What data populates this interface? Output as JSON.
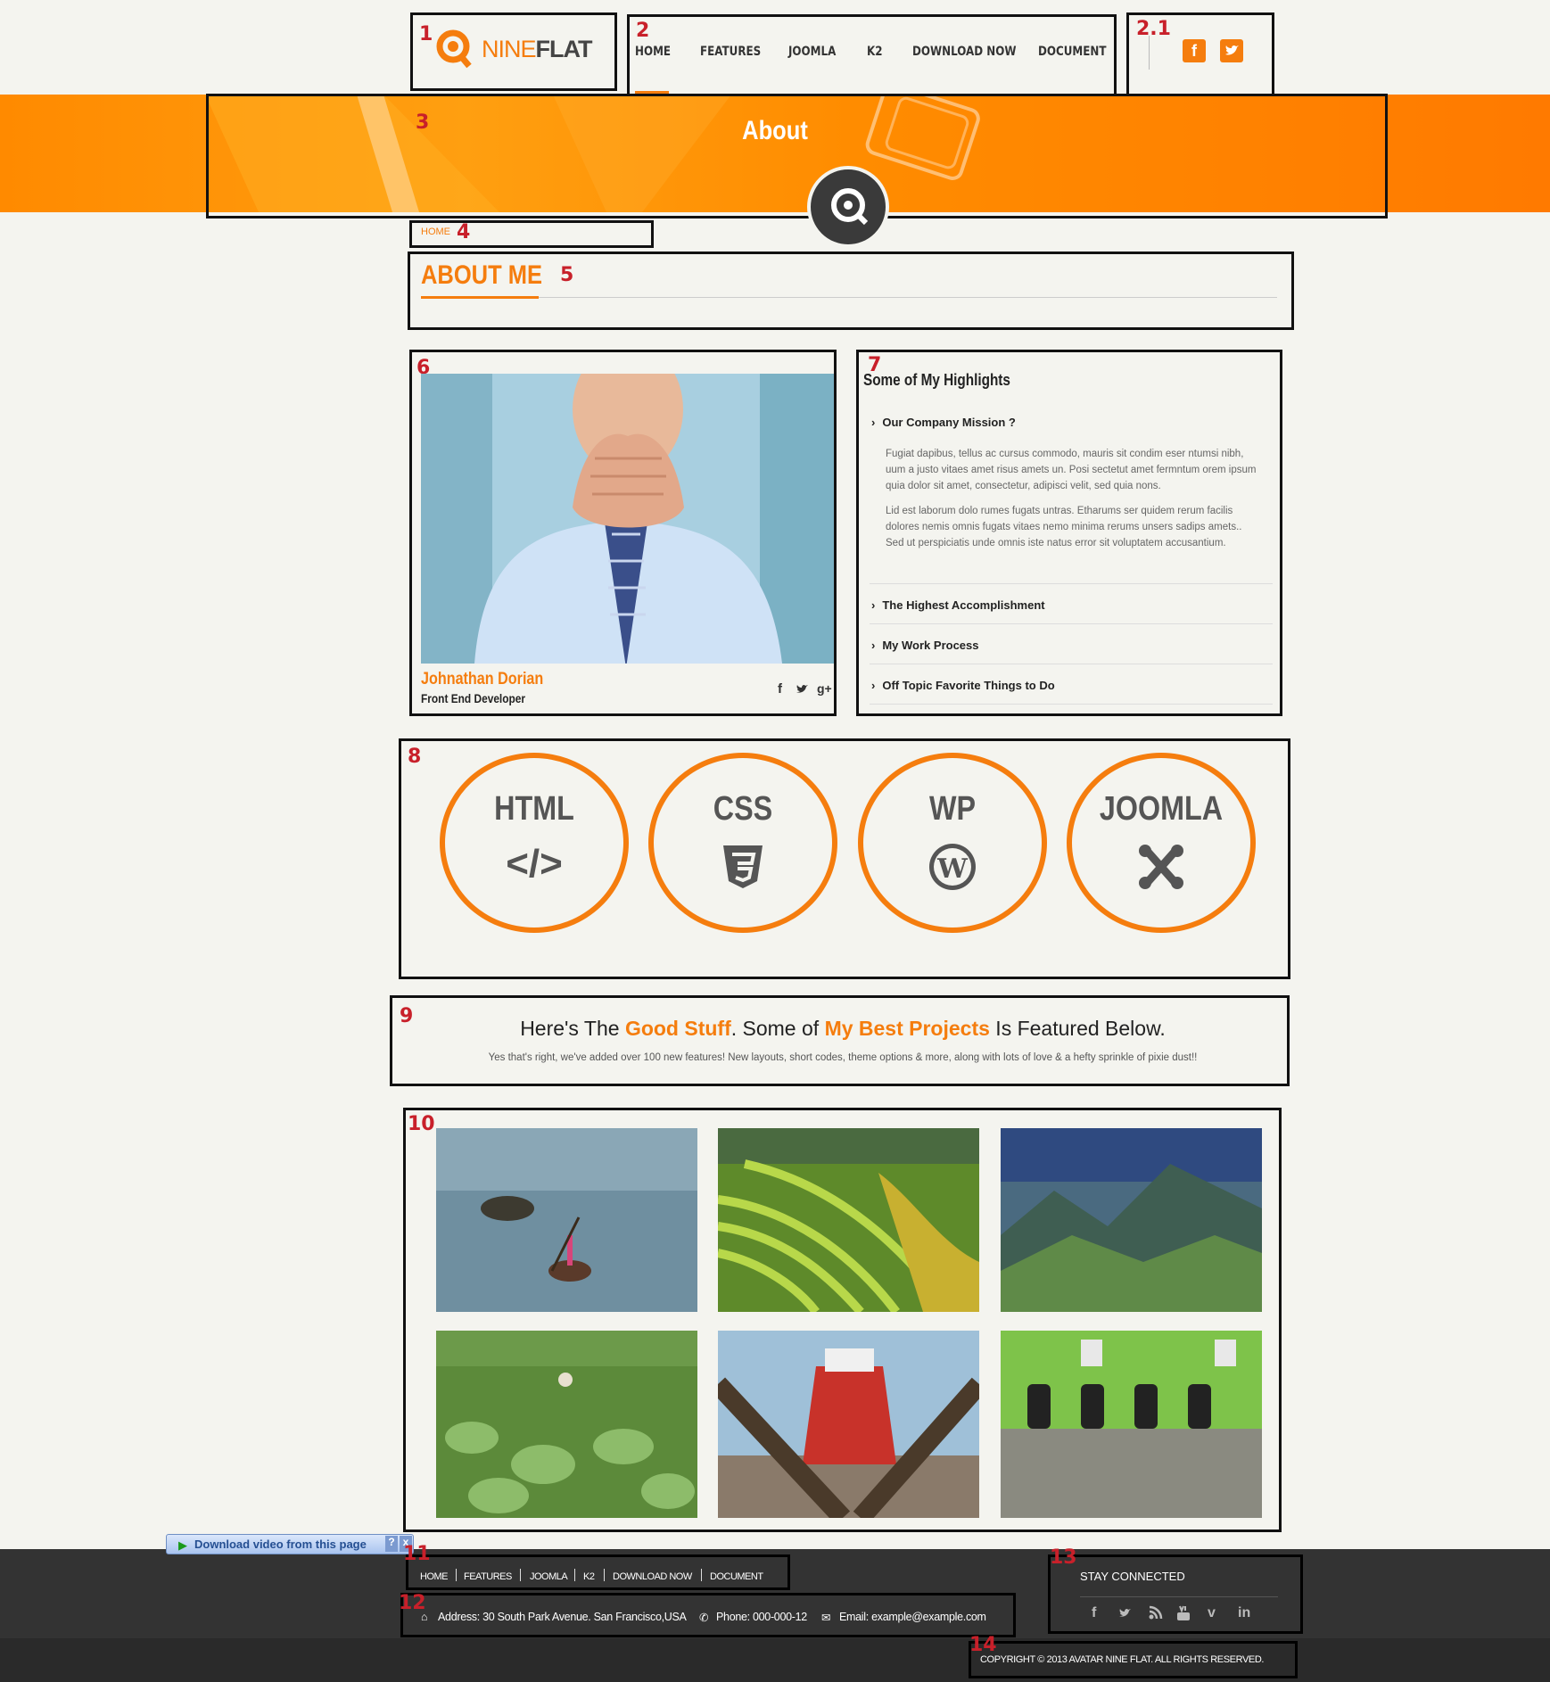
{
  "annotations": [
    "1",
    "2",
    "2.1",
    "3",
    "4",
    "5",
    "6",
    "7",
    "8",
    "9",
    "10",
    "11",
    "12",
    "13",
    "14"
  ],
  "logo": {
    "part1": "NINE",
    "part2": "FLAT"
  },
  "nav": [
    "HOME",
    "FEATURES",
    "JOOMLA",
    "K2",
    "DOWNLOAD NOW",
    "DOCUMENT"
  ],
  "social_top": [
    {
      "icon": "facebook-icon",
      "glyph": "f"
    },
    {
      "icon": "twitter-icon",
      "glyph": "t"
    }
  ],
  "banner": {
    "title": "About"
  },
  "breadcrumb": {
    "home": "HOME"
  },
  "about": {
    "title": "ABOUT ME"
  },
  "profile": {
    "name": "Johnathan Dorian",
    "role": "Front End Developer",
    "social": [
      "f",
      "t",
      "g+"
    ]
  },
  "highlights": {
    "title": "Some of My Highlights",
    "items": [
      "Our Company Mission ?",
      "The Highest Accomplishment",
      "My Work Process",
      "Off Topic Favorite Things to Do"
    ],
    "para1": "Fugiat dapibus, tellus ac cursus commodo, mauris sit condim eser ntumsi nibh, uum a justo vitaes amet risus amets un. Posi sectetut amet fermntum orem ipsum quia dolor sit amet, consectetur, adipisci velit, sed quia nons.",
    "para2": "Lid est laborum dolo rumes fugats untras. Etharums ser quidem rerum facilis dolores nemis omnis fugats vitaes nemo minima rerums unsers sadips amets.. Sed ut perspiciatis unde omnis iste natus error sit voluptatem accusantium."
  },
  "skills": [
    {
      "label": "HTML",
      "icon": "code-icon",
      "glyph": "</>"
    },
    {
      "label": "CSS",
      "icon": "css3-icon",
      "glyph": "3"
    },
    {
      "label": "WP",
      "icon": "wordpress-icon",
      "glyph": "W"
    },
    {
      "label": "JOOMLA",
      "icon": "joomla-icon",
      "glyph": "✲"
    }
  ],
  "featured": {
    "t1": "Here's The ",
    "t2": "Good Stuff",
    "t3": ". Some of ",
    "t4": "My Best Projects",
    "t5": " Is Featured Below.",
    "subtitle": "Yes that's right, we've added over 100 new features! New layouts, short codes, theme options & more, along with lots of love & a hefty sprinkle of pixie dust!!"
  },
  "gallery_colors": {
    "sea": "#5f7d8e",
    "terraces": "#7aa43a",
    "mountains": "#4d6b55",
    "taro": "#5e8a3a",
    "ship": "#b8453a",
    "office": "#7ec34a"
  },
  "footer": {
    "download_bar": "Download video from this page",
    "nav": [
      "HOME",
      "FEATURES",
      "JOOMLA",
      "K2",
      "DOWNLOAD NOW",
      "DOCUMENT"
    ],
    "address": "Address: 30 South Park Avenue. San Francisco,USA",
    "phone": "Phone: 000-000-12",
    "email": "Email: example@example.com",
    "stay_connected": "STAY CONNECTED",
    "social": [
      "f",
      "t",
      "rss",
      "yt",
      "v",
      "in"
    ],
    "copyright": "COPYRIGHT © 2013 AVATAR NINE FLAT. ALL RIGHTS RESERVED."
  },
  "colors": {
    "accent": "#f57d0e",
    "annotation": "#c8202a",
    "footer_bg": "#333333"
  }
}
